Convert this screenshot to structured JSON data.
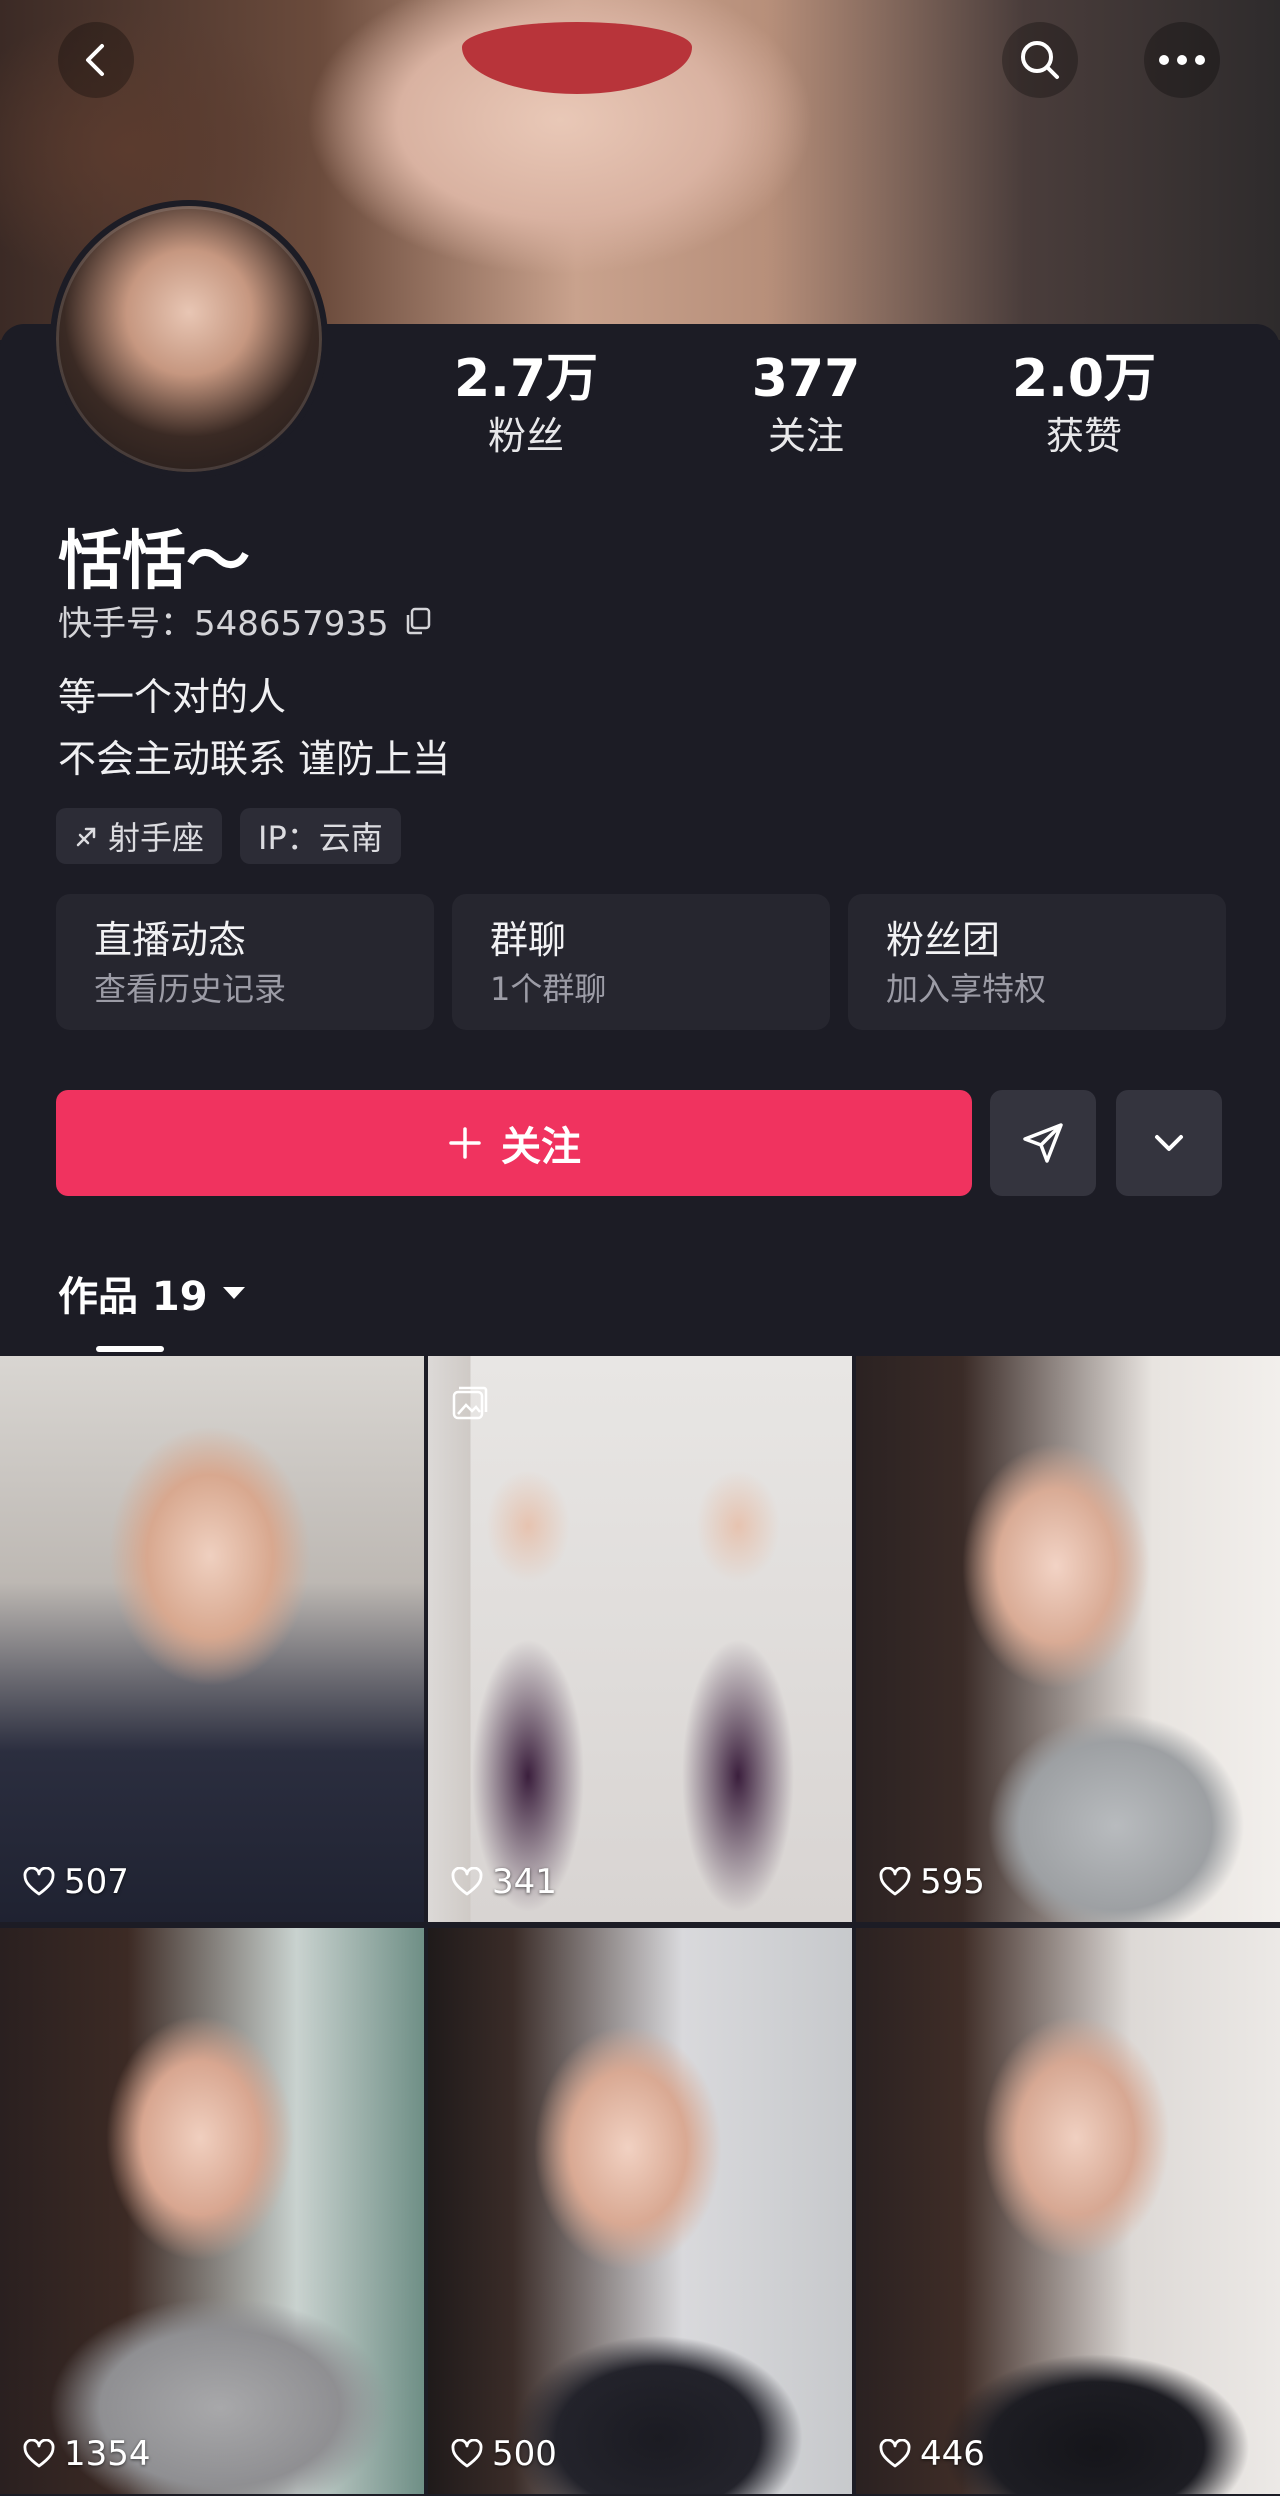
{
  "profile": {
    "stats": [
      {
        "value": "2.7万",
        "label": "粉丝"
      },
      {
        "value": "377",
        "label": "关注"
      },
      {
        "value": "2.0万",
        "label": "获赞"
      }
    ],
    "name": "恬恬～",
    "id_label": "快手号：548657935",
    "bio_line1": "等一个对的人",
    "bio_line2": "不会主动联系 谨防上当",
    "tags": [
      "射手座",
      "IP：云南"
    ]
  },
  "cards": [
    {
      "title": "直播动态",
      "subtitle": "查看历史记录"
    },
    {
      "title": "群聊",
      "subtitle": "1个群聊"
    },
    {
      "title": "粉丝团",
      "subtitle": "加入享特权"
    }
  ],
  "actions": {
    "follow_label": "关注"
  },
  "works": {
    "label": "作品 19"
  },
  "tiles": [
    {
      "likes": "507"
    },
    {
      "likes": "341"
    },
    {
      "likes": "595"
    },
    {
      "likes": "1354"
    },
    {
      "likes": "500"
    },
    {
      "likes": "446"
    }
  ]
}
